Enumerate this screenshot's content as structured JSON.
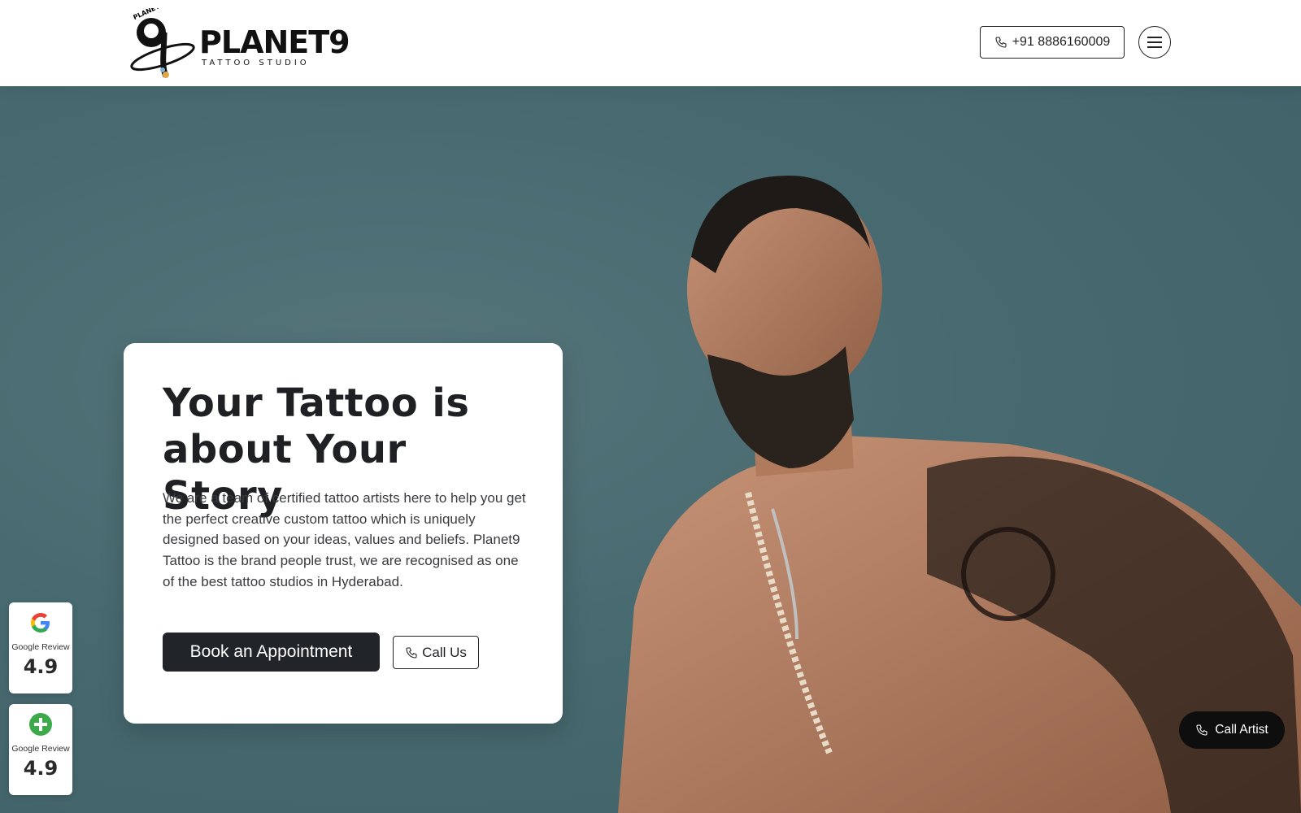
{
  "header": {
    "logo": {
      "wordmark": "PLANET9",
      "tagline": "TATTOO STUDIO",
      "emblem_text": "PLANET"
    },
    "phone_button": {
      "label": "+91 8886160009",
      "icon": "phone-icon"
    },
    "menu_button": {
      "icon": "hamburger-menu-icon"
    }
  },
  "hero": {
    "headline": "Your Tattoo is about Your Story",
    "description": "We are a team of certified tattoo artists here to help you get the perfect creative custom tattoo which is uniquely designed based on your ideas, values and beliefs. Planet9 Tattoo is the brand people trust, we are recognised as one of the best tattoo studios in Hyderabad.",
    "book_button": "Book an Appointment",
    "call_button": "Call Us",
    "background_color": "#476a70"
  },
  "reviews": [
    {
      "icon": "google-g-icon",
      "label": "Google Review",
      "score": "4.9"
    },
    {
      "icon": "green-plus-icon",
      "label": "Google Review",
      "score": "4.9"
    }
  ],
  "call_artist": {
    "label": "Call Artist",
    "icon": "phone-icon"
  }
}
